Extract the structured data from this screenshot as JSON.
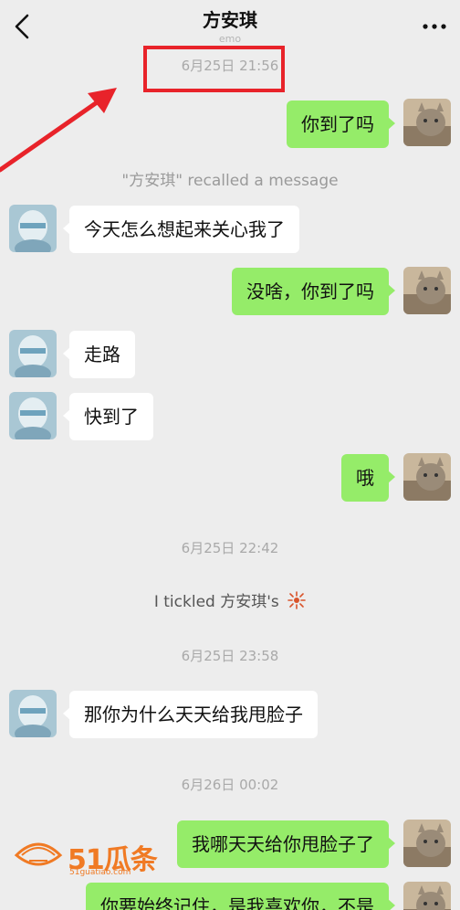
{
  "header": {
    "title": "方安琪",
    "subtitle": "emo"
  },
  "messages": {
    "t1": "6月25日 21:56",
    "m1": "你到了吗",
    "recall": "\"方安琪\" recalled a message",
    "m2": "今天怎么想起来关心我了",
    "m3": "没啥，你到了吗",
    "m4": "走路",
    "m5": "快到了",
    "m6": "哦",
    "t2": "6月25日 22:42",
    "tickle": "I  tickled 方安琪's",
    "t3": "6月25日 23:58",
    "m7": "那你为什么天天给我甩脸子",
    "t4": "6月26日 00:02",
    "m8": "我哪天天给你甩脸子了",
    "m9": "你要始终记住，是我喜欢你，不是"
  },
  "watermark": {
    "brand": "51瓜条",
    "url": "51guatiao.com"
  },
  "colors": {
    "background": "#ededed",
    "outgoing_bubble": "#95ec69",
    "incoming_bubble": "#ffffff",
    "annotation_red": "#e8232a",
    "watermark_orange": "#f07a24"
  },
  "icons": {
    "back": "chevron-left-icon",
    "more": "more-dots-icon"
  }
}
